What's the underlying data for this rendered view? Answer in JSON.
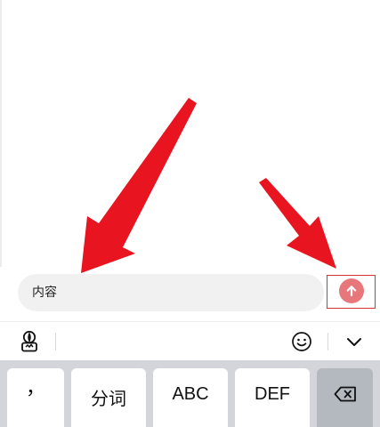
{
  "input": {
    "value": "内容"
  },
  "keyboard": {
    "keys": [
      {
        "label": "，"
      },
      {
        "label": "分词"
      },
      {
        "label": "ABC"
      },
      {
        "label": "DEF"
      }
    ]
  },
  "colors": {
    "arrow": "#e8141f",
    "highlight_box": "#d6333a",
    "send_button": "#e8777b",
    "keyboard_bg": "#d3d5da",
    "input_bg": "#f1f1f1"
  },
  "icons": {
    "toolbar_left": "keyboard-settings-icon",
    "emoji": "smiley-icon",
    "collapse": "chevron-down-icon",
    "send": "arrow-up-icon",
    "delete": "backspace-icon"
  }
}
